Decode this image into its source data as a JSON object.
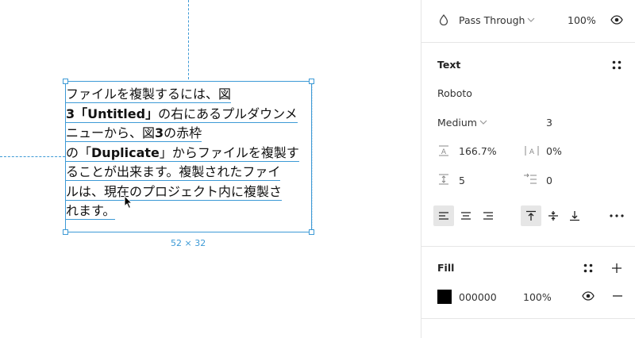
{
  "canvas": {
    "text_lines": [
      [
        "ファイルを複製するには、図"
      ],
      [
        "**3「Untitled」",
        "の右にあるプルダウンメ"
      ],
      [
        "ニューから、図",
        "**3",
        "の赤枠"
      ],
      [
        "の「",
        "**Duplicate",
        "」からファイルを複製す"
      ],
      [
        "ることが出来ます。複製されたファイ"
      ],
      [
        "ルは、現在のプロジェクト内に複製さ"
      ],
      [
        "れます。"
      ]
    ],
    "size_label": "52 × 32"
  },
  "layer": {
    "blend_mode": "Pass Through",
    "opacity": "100%"
  },
  "text": {
    "title": "Text",
    "font_family": "Roboto",
    "font_weight": "Medium",
    "font_size": "3",
    "line_height": "166.7%",
    "letter_spacing": "0%",
    "paragraph_spacing": "5",
    "paragraph_indent": "0"
  },
  "fill": {
    "title": "Fill",
    "hex": "000000",
    "opacity": "100%",
    "color": "#000000"
  },
  "colors": {
    "selection": "#3d9ad6",
    "panel_border": "#e6e6e6"
  }
}
